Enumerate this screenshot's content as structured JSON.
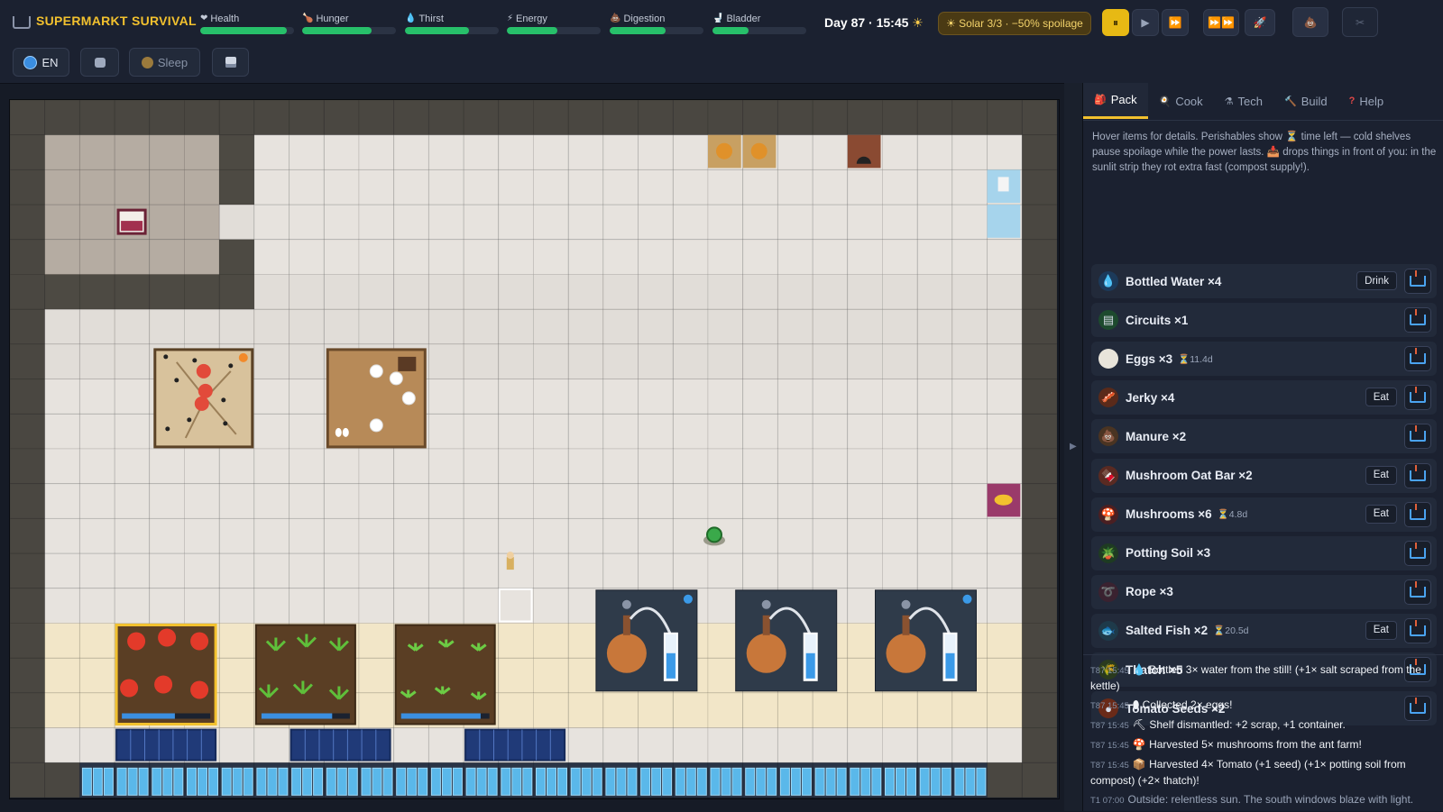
{
  "app": {
    "title": "SUPERMARKT SURVIVAL"
  },
  "stats": [
    {
      "label": "Health",
      "icon": "heart-icon",
      "level": 0.92,
      "color": "#27c06a"
    },
    {
      "label": "Hunger",
      "icon": "drumstick-icon",
      "level": 0.74,
      "color": "#27c06a"
    },
    {
      "label": "Thirst",
      "icon": "droplet-icon",
      "level": 0.68,
      "color": "#27c06a"
    },
    {
      "label": "Energy",
      "icon": "lightning-icon",
      "level": 0.54,
      "color": "#27c06a"
    },
    {
      "label": "Digestion",
      "icon": "poop-icon",
      "level": 0.6,
      "color": "#27c06a"
    },
    {
      "label": "Bladder",
      "icon": "toilet-icon",
      "level": 0.38,
      "color": "#27c06a"
    }
  ],
  "clock": {
    "text": "Day 87 · 15:45",
    "weather_icon": "sun-icon"
  },
  "solar": {
    "text": "☀ Solar 3/3 · −50% spoilage"
  },
  "speed_controls": [
    {
      "name": "pause",
      "symbol": "⏸",
      "active": true
    },
    {
      "name": "play",
      "symbol": "▶",
      "active": false
    },
    {
      "name": "fast",
      "symbol": "⏩",
      "active": false
    },
    {
      "name": "fastest",
      "symbol": "⏩⏩",
      "active": false
    },
    {
      "name": "rocket",
      "symbol": "🚀",
      "active": false
    }
  ],
  "toolbar": {
    "language": "EN",
    "sleep_label": "Sleep"
  },
  "tabs": [
    {
      "label": "Pack",
      "icon": "backpack-icon",
      "active": true
    },
    {
      "label": "Cook",
      "icon": "cook-icon",
      "active": false
    },
    {
      "label": "Tech",
      "icon": "flask-icon",
      "active": false
    },
    {
      "label": "Build",
      "icon": "hammer-icon",
      "active": false
    },
    {
      "label": "Help",
      "icon": "question-icon",
      "active": false
    }
  ],
  "inventory_hint": "Hover items for details. Perishables show ⏳ time left — cold shelves pause spoilage while the power lasts. 📥 drops things in front of you: in the sunlit strip they rot extra fast (compost supply!).",
  "inventory": [
    {
      "name": "Bottled Water ×4",
      "icon": "water-icon",
      "glyph": "💧",
      "ttl": "",
      "action": "Drink"
    },
    {
      "name": "Circuits ×1",
      "icon": "circuit-icon",
      "glyph": "▤",
      "ttl": "",
      "action": ""
    },
    {
      "name": "Eggs ×3",
      "icon": "egg-icon",
      "glyph": "⬮",
      "ttl": "⏳11.4d",
      "action": ""
    },
    {
      "name": "Jerky ×4",
      "icon": "jerky-icon",
      "glyph": "🥓",
      "ttl": "",
      "action": "Eat"
    },
    {
      "name": "Manure ×2",
      "icon": "manure-icon",
      "glyph": "💩",
      "ttl": "",
      "action": ""
    },
    {
      "name": "Mushroom Oat Bar ×2",
      "icon": "oat-bar-icon",
      "glyph": "🍫",
      "ttl": "",
      "action": "Eat"
    },
    {
      "name": "Mushrooms ×6",
      "icon": "mushroom-icon",
      "glyph": "🍄",
      "ttl": "⏳4.8d",
      "action": "Eat"
    },
    {
      "name": "Potting Soil ×3",
      "icon": "potted-plant-icon",
      "glyph": "🪴",
      "ttl": "",
      "action": ""
    },
    {
      "name": "Rope ×3",
      "icon": "rope-icon",
      "glyph": "➰",
      "ttl": "",
      "action": ""
    },
    {
      "name": "Salted Fish ×2",
      "icon": "fish-icon",
      "glyph": "🐟",
      "ttl": "⏳20.5d",
      "action": "Eat"
    },
    {
      "name": "Thatch ×5",
      "icon": "thatch-icon",
      "glyph": "🌾",
      "ttl": "",
      "action": ""
    },
    {
      "name": "Tomato Seeds ×2",
      "icon": "seed-icon",
      "glyph": "●",
      "ttl": "",
      "action": ""
    }
  ],
  "log": [
    {
      "time": "T87 15:45",
      "icon": "💧",
      "text": "Bottled 3× water from the still! (+1× salt scraped from the kettle)"
    },
    {
      "time": "T87 15:45",
      "icon": "⬮",
      "text": "Collected 2× eggs!"
    },
    {
      "time": "T87 15:45",
      "icon": "⛏",
      "text": "Shelf dismantled: +2 scrap, +1 container."
    },
    {
      "time": "T87 15:45",
      "icon": "🍄",
      "text": "Harvested 5× mushrooms from the ant farm!"
    },
    {
      "time": "T87 15:45",
      "icon": "📦",
      "text": "Harvested 4× Tomato (+1 seed) (+1× potting soil from compost) (+2× thatch)!"
    },
    {
      "time": "T1 07:00",
      "icon": "",
      "text": "Outside: relentless sun. The south windows blaze with light."
    }
  ],
  "board": {
    "planters": [
      {
        "crop": "tomato",
        "growth": 0.6,
        "selected": true
      },
      {
        "crop": "leafy",
        "growth": 0.8,
        "selected": false
      },
      {
        "crop": "sprout",
        "growth": 0.9,
        "selected": false
      }
    ],
    "stills": [
      {
        "ready": true
      },
      {
        "ready": false
      },
      {
        "ready": true
      }
    ]
  },
  "colors": {
    "accent": "#f2c12e",
    "ok": "#27c06a",
    "progress": "#3b8fe0"
  }
}
